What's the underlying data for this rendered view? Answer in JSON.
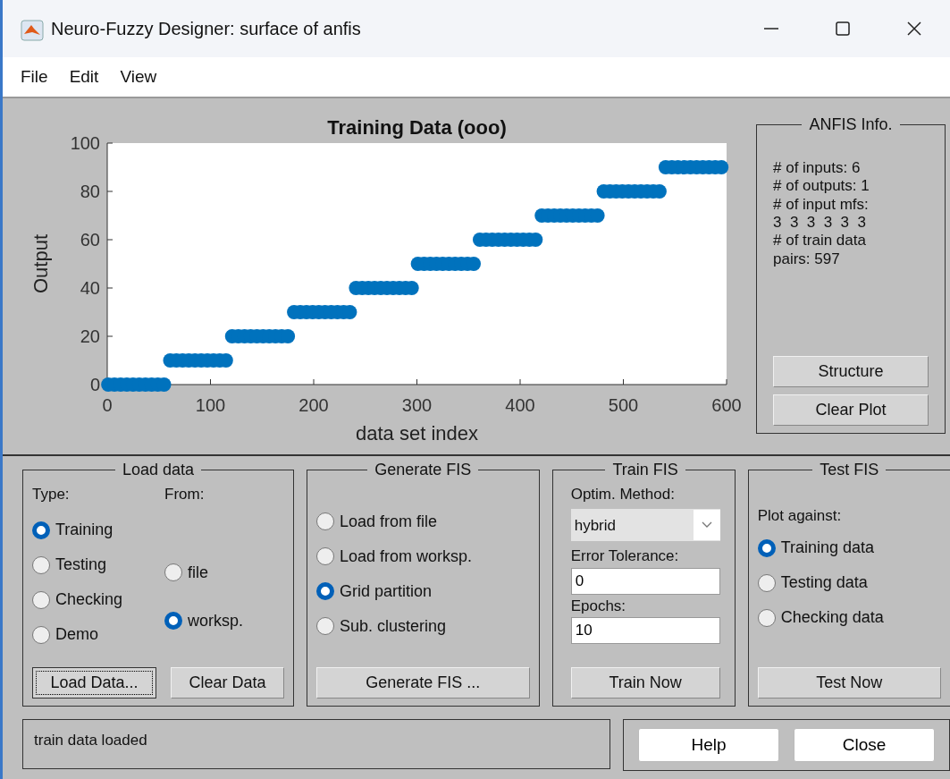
{
  "window": {
    "title": "Neuro-Fuzzy Designer: surface of anfis"
  },
  "menu": [
    "File",
    "Edit",
    "View"
  ],
  "plot": {
    "chart_data": {
      "type": "scatter",
      "title": "Training Data (ooo)",
      "xlabel": "data set index",
      "ylabel": "Output",
      "xlim": [
        0,
        600
      ],
      "ylim": [
        0,
        100
      ],
      "xticks": [
        0,
        100,
        200,
        300,
        400,
        500,
        600
      ],
      "yticks": [
        0,
        20,
        40,
        60,
        80,
        100
      ],
      "x": [
        1,
        7,
        13,
        19,
        25,
        31,
        37,
        43,
        49,
        55,
        61,
        67,
        73,
        79,
        85,
        91,
        97,
        103,
        109,
        115,
        121,
        127,
        133,
        139,
        145,
        151,
        157,
        163,
        169,
        175,
        181,
        187,
        193,
        199,
        205,
        211,
        217,
        223,
        229,
        235,
        241,
        247,
        253,
        259,
        265,
        271,
        277,
        283,
        289,
        295,
        301,
        307,
        313,
        319,
        325,
        331,
        337,
        343,
        349,
        355,
        361,
        367,
        373,
        379,
        385,
        391,
        397,
        403,
        409,
        415,
        421,
        427,
        433,
        439,
        445,
        451,
        457,
        463,
        469,
        475,
        481,
        487,
        493,
        499,
        505,
        511,
        517,
        523,
        529,
        535,
        541,
        547,
        553,
        559,
        565,
        571,
        577,
        583,
        589,
        595
      ],
      "series": [
        {
          "color": "#0072bd",
          "values": [
            0,
            0,
            0,
            0,
            0,
            0,
            0,
            0,
            0,
            0,
            10,
            10,
            10,
            10,
            10,
            10,
            10,
            10,
            10,
            10,
            20,
            20,
            20,
            20,
            20,
            20,
            20,
            20,
            20,
            20,
            30,
            30,
            30,
            30,
            30,
            30,
            30,
            30,
            30,
            30,
            40,
            40,
            40,
            40,
            40,
            40,
            40,
            40,
            40,
            40,
            50,
            50,
            50,
            50,
            50,
            50,
            50,
            50,
            50,
            50,
            60,
            60,
            60,
            60,
            60,
            60,
            60,
            60,
            60,
            60,
            70,
            70,
            70,
            70,
            70,
            70,
            70,
            70,
            70,
            70,
            80,
            80,
            80,
            80,
            80,
            80,
            80,
            80,
            80,
            80,
            90,
            90,
            90,
            90,
            90,
            90,
            90,
            90,
            90,
            90
          ]
        }
      ]
    }
  },
  "anfis_info": {
    "title": "ANFIS Info.",
    "lines": [
      "# of inputs: 6",
      "# of outputs: 1",
      "# of input mfs:",
      "3  3  3  3  3  3",
      "# of train data",
      "pairs: 597"
    ],
    "buttons": [
      "Structure",
      "Clear Plot"
    ]
  },
  "load_data": {
    "title": "Load data",
    "type_label": "Type:",
    "from_label": "From:",
    "types": [
      {
        "label": "Training",
        "selected": true
      },
      {
        "label": "Testing",
        "selected": false
      },
      {
        "label": "Checking",
        "selected": false
      },
      {
        "label": "Demo",
        "selected": false
      }
    ],
    "sources": [
      {
        "label": "file",
        "selected": false
      },
      {
        "label": "worksp.",
        "selected": true
      }
    ],
    "buttons": [
      {
        "label": "Load Data...",
        "focused": true
      },
      {
        "label": "Clear Data",
        "focused": false
      }
    ]
  },
  "generate_fis": {
    "title": "Generate FIS",
    "options": [
      {
        "label": "Load from file",
        "selected": false
      },
      {
        "label": "Load from worksp.",
        "selected": false
      },
      {
        "label": "Grid partition",
        "selected": true
      },
      {
        "label": "Sub. clustering",
        "selected": false
      }
    ],
    "button": "Generate FIS ..."
  },
  "train_fis": {
    "title": "Train FIS",
    "method_label": "Optim. Method:",
    "method": "hybrid",
    "tolerance_label": "Error Tolerance:",
    "tolerance": "0",
    "epochs_label": "Epochs:",
    "epochs": "10",
    "button": "Train Now"
  },
  "test_fis": {
    "title": "Test FIS",
    "plot_label": "Plot against:",
    "options": [
      {
        "label": "Training data",
        "selected": true
      },
      {
        "label": "Testing data",
        "selected": false
      },
      {
        "label": "Checking data",
        "selected": false
      }
    ],
    "button": "Test Now"
  },
  "status": "train data loaded",
  "dialog_buttons": [
    "Help",
    "Close"
  ]
}
